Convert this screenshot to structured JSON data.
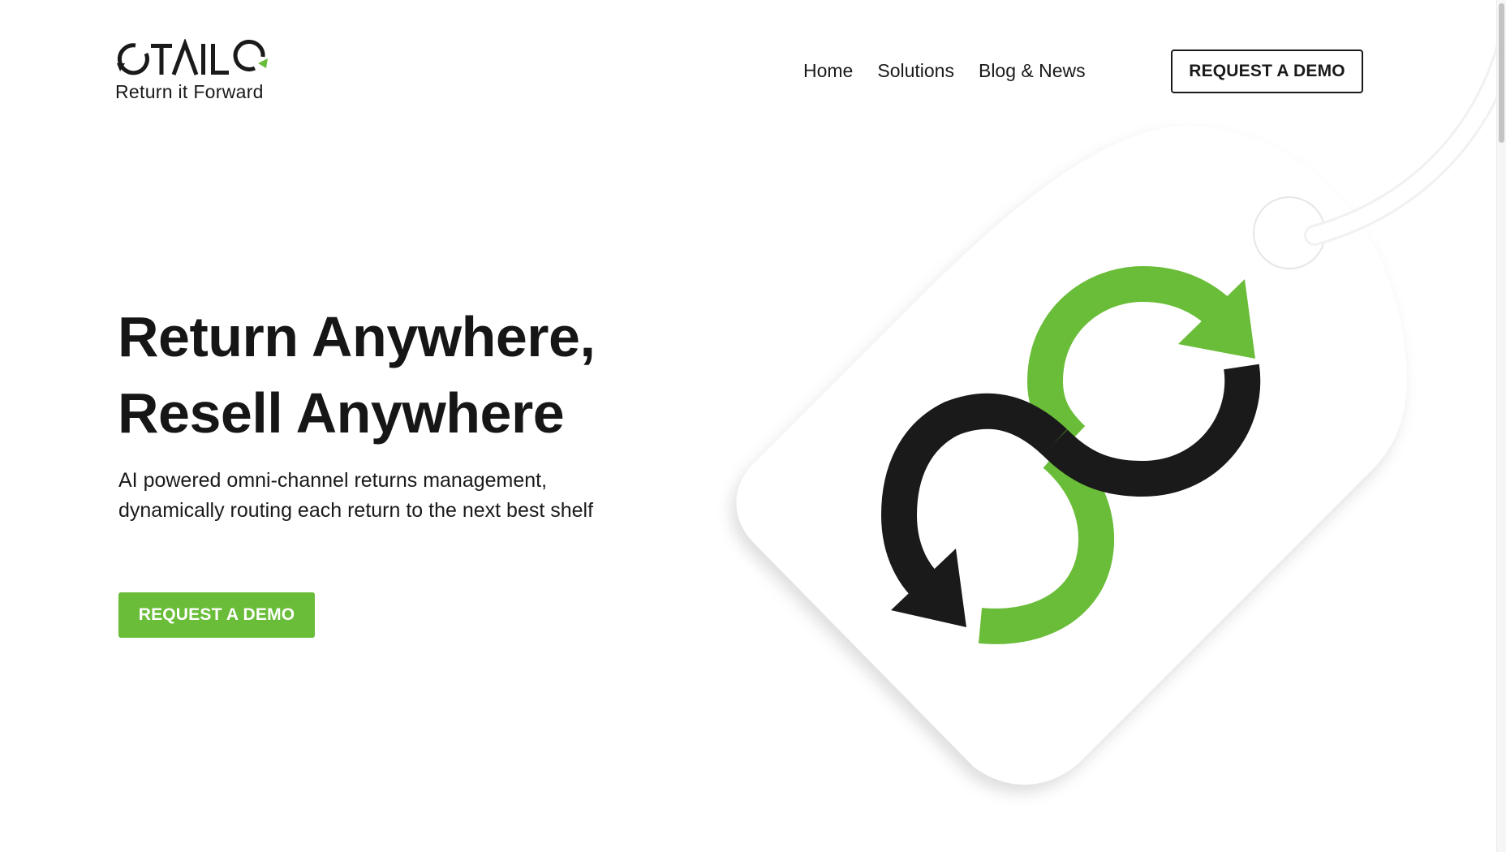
{
  "brand": {
    "logo_word": "OTAILO",
    "tagline": "Return it Forward",
    "accent_color": "#6abd39",
    "dark_color": "#1a1a1a"
  },
  "nav": {
    "items": [
      "Home",
      "Solutions",
      "Blog & News"
    ],
    "cta_label": "REQUEST A DEMO"
  },
  "hero": {
    "title_line1": "Return Anywhere,",
    "title_line2": "Resell Anywhere",
    "subtitle": "AI powered omni-channel returns management, dynamically routing each return to the next best shelf",
    "cta_label": "REQUEST A DEMO",
    "illustration_icon": "infinity-return-arrows-icon"
  }
}
